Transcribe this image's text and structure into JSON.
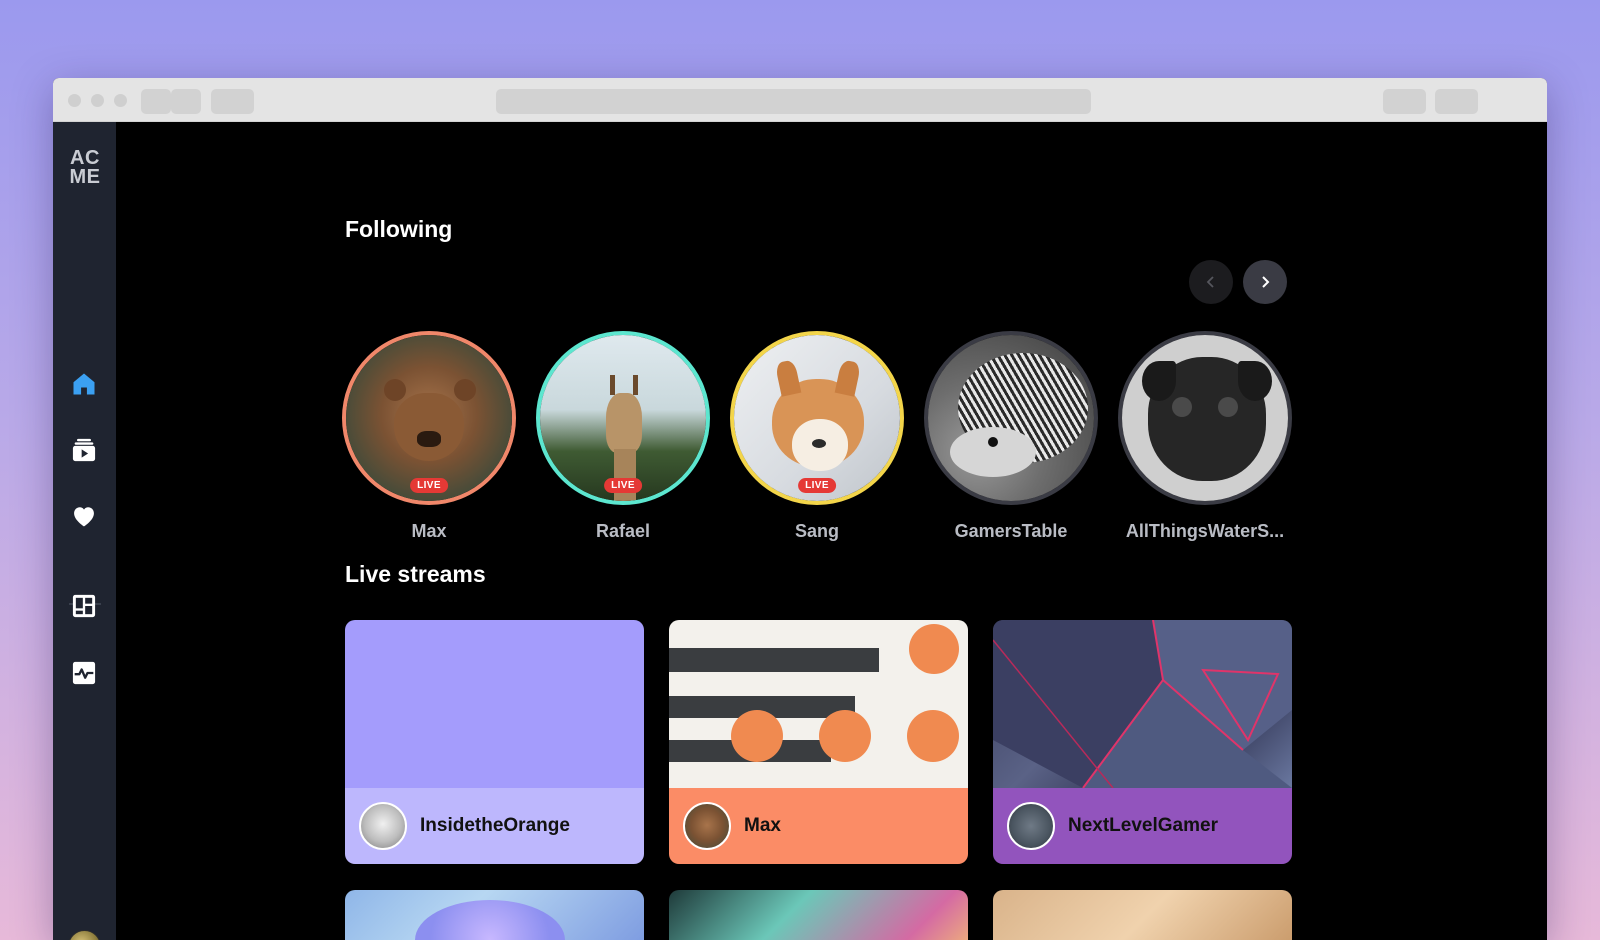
{
  "app": {
    "logo_text": "AC ME"
  },
  "sidebar": {
    "items": [
      {
        "name": "home",
        "icon": "home-icon",
        "active": true
      },
      {
        "name": "videos",
        "icon": "video-library-icon",
        "active": false
      },
      {
        "name": "favorites",
        "icon": "heart-icon",
        "active": false
      },
      {
        "name": "dashboard",
        "icon": "dashboard-icon",
        "active": false
      },
      {
        "name": "activity",
        "icon": "activity-icon",
        "active": false
      }
    ],
    "accent_color": "#3ba0f2"
  },
  "following": {
    "title": "Following",
    "prev_icon": "chevron-left-icon",
    "next_icon": "chevron-right-icon",
    "items": [
      {
        "name": "Max",
        "live": true,
        "live_label": "LIVE",
        "ring_color": "#f0876a"
      },
      {
        "name": "Rafael",
        "live": true,
        "live_label": "LIVE",
        "ring_color": "#5ce6cf"
      },
      {
        "name": "Sang",
        "live": true,
        "live_label": "LIVE",
        "ring_color": "#f3d54a"
      },
      {
        "name": "GamersTable",
        "live": false,
        "ring_color": "#3a3b44"
      },
      {
        "name": "AllThingsWaterS...",
        "live": false,
        "ring_color": "#3a3b44"
      }
    ]
  },
  "live_streams": {
    "title": "Live streams",
    "cards": [
      {
        "name": "InsidetheOrange",
        "thumb_color": "#a49cfc",
        "footer_color": "#bdb7fd"
      },
      {
        "name": "Max",
        "thumb_color": "#f3f1ec",
        "footer_color": "#fb8c66"
      },
      {
        "name": "NextLevelGamer",
        "thumb_color": "#4a4f72",
        "footer_color": "#9254bd"
      }
    ]
  }
}
